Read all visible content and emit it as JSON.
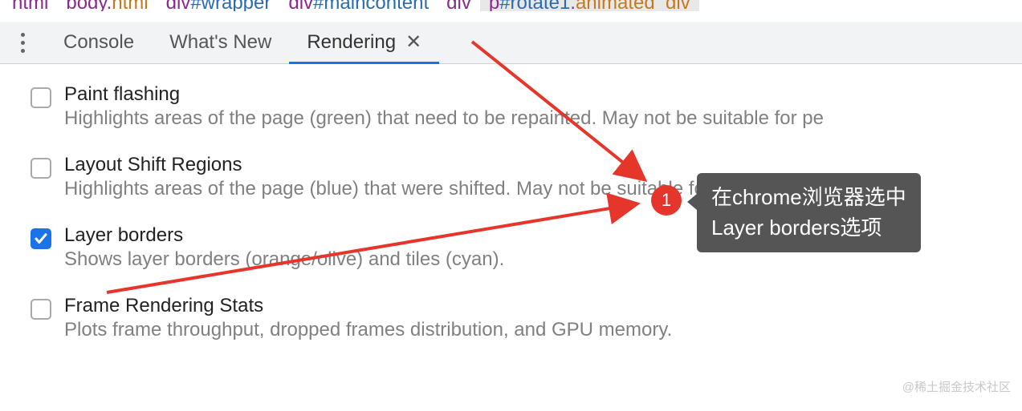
{
  "breadcrumb": [
    {
      "tag": "html",
      "cls": "",
      "id": ""
    },
    {
      "tag": "body",
      "cls": "html",
      "id": ""
    },
    {
      "tag": "div",
      "cls": "",
      "id": "wrapper"
    },
    {
      "tag": "div",
      "cls": "",
      "id": "maincontent"
    },
    {
      "tag": "div",
      "cls": "",
      "id": ""
    },
    {
      "tag": "p",
      "cls": "animated_div",
      "id": "rotate1"
    }
  ],
  "tabs": {
    "console": "Console",
    "whatsnew": "What's New",
    "rendering": "Rendering"
  },
  "options": {
    "paint": {
      "title": "Paint flashing",
      "desc": "Highlights areas of the page (green) that need to be repainted. May not be suitable for pe"
    },
    "shift": {
      "title": "Layout Shift Regions",
      "desc": "Highlights areas of the page (blue) that were shifted. May not be suitable for people prone"
    },
    "layer": {
      "title": "Layer borders",
      "desc": "Shows layer borders (orange/olive) and tiles (cyan)."
    },
    "frame": {
      "title": "Frame Rendering Stats",
      "desc": "Plots frame throughput, dropped frames distribution, and GPU memory."
    }
  },
  "annotation": {
    "number": "1",
    "line1": "在chrome浏览器选中",
    "line2": "Layer borders选项"
  },
  "watermark": "@稀土掘金技术社区"
}
